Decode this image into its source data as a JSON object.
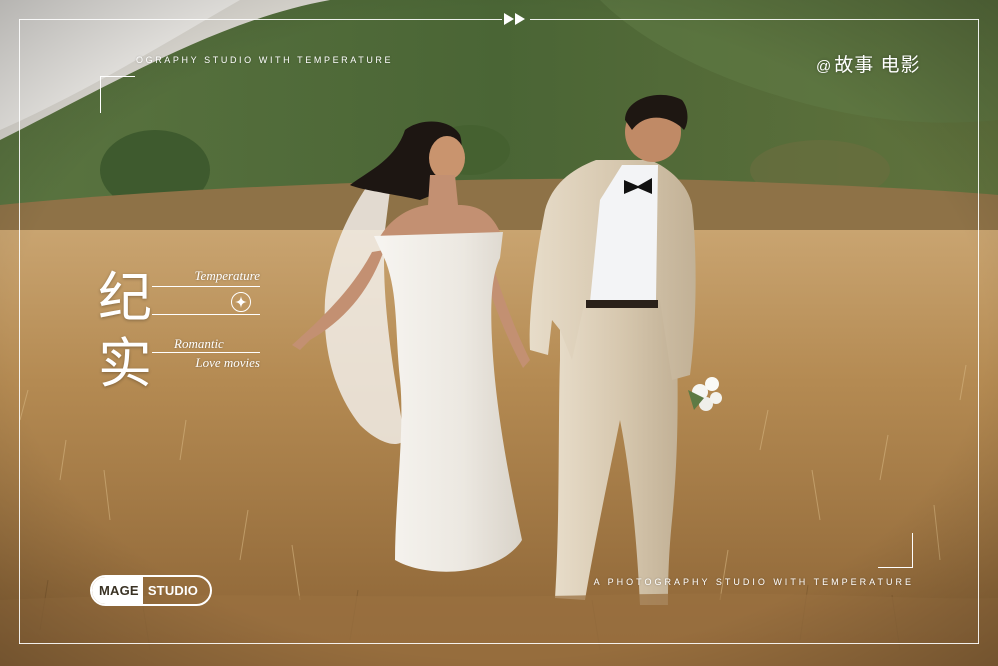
{
  "overlay": {
    "tagline_top": "OGRAPHY STUDIO WITH TEMPERATURE",
    "tagline_bottom": "A PHOTOGRAPHY STUDIO WITH TEMPERATURE",
    "handle_symbol": "@",
    "handle_text": "故事 电影",
    "title_char_1": "纪",
    "title_char_2": "实",
    "script_1": "Temperature",
    "script_2": "Romantic",
    "script_3": "Love movies",
    "logo_word_1": "MAGE",
    "logo_word_2": "STUDIO"
  },
  "icons": {
    "play": "fast-forward-icon",
    "star": "four-point-star-icon"
  },
  "colors": {
    "overlay_text": "#ffffff",
    "grass_gold": "#b48a52",
    "hill_green": "#4f6a3a",
    "sky": "#e8e6e1",
    "dress_white": "#f5f3ef",
    "suit_beige": "#ddd0bb"
  }
}
